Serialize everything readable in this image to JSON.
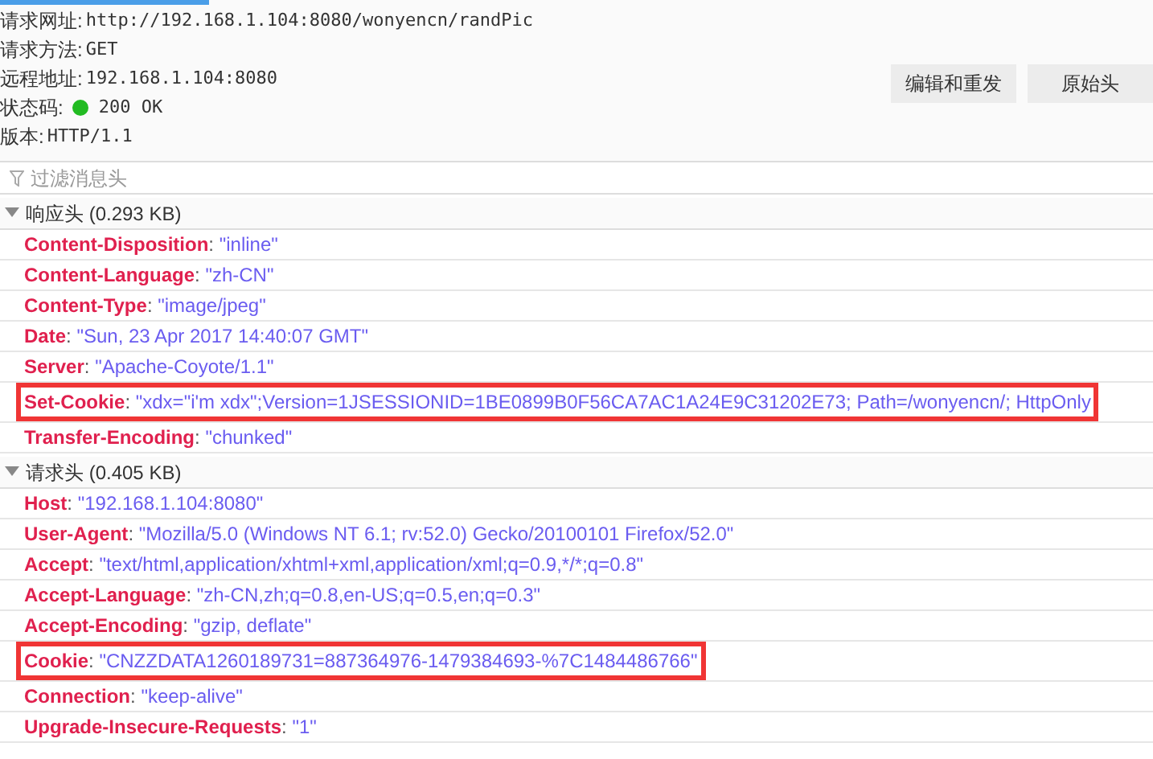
{
  "summary": [
    {
      "label": "请求网址:",
      "value": "http://192.168.1.104:8080/wonyencn/randPic"
    },
    {
      "label": "请求方法:",
      "value": "GET"
    },
    {
      "label": "远程地址:",
      "value": "192.168.1.104:8080"
    },
    {
      "label": "状态码:",
      "value": "200 OK",
      "color": "#22bb22"
    },
    {
      "label": "版本:",
      "value": "HTTP/1.1"
    }
  ],
  "buttons": [
    "编辑和重发",
    "原始头"
  ],
  "filter": {
    "placeholder": "过滤消息头"
  },
  "sections": [
    {
      "title": "响应头 (0.293 KB)",
      "expanded": true,
      "headers": [
        {
          "name": "Content-Disposition",
          "colon": ":",
          "value": "\"inline\"",
          "highlighted": false
        },
        {
          "name": "Content-Language",
          "colon": ":",
          "value": "\"zh-CN\"",
          "highlighted": false
        },
        {
          "name": "Content-Type",
          "colon": ":",
          "value": "\"image/jpeg\"",
          "highlighted": false
        },
        {
          "name": "Date",
          "colon": ":",
          "value": "\"Sun, 23 Apr 2017 14:40:07 GMT\"",
          "highlighted": false
        },
        {
          "name": "Server",
          "colon": ":",
          "value": "\"Apache-Coyote/1.1\"",
          "highlighted": false
        },
        {
          "name": "Set-Cookie",
          "colon": ":",
          "value": "\"xdx=\"i'm xdx\";Version=1JSESSIONID=1BE0899B0F56CA7AC1A24E9C31202E73; Path=/wonyencn/; HttpOnly",
          "highlighted": true
        },
        {
          "name": "Transfer-Encoding",
          "colon": ":",
          "value": "\"chunked\"",
          "highlighted": false
        }
      ]
    },
    {
      "title": "请求头 (0.405 KB)",
      "expanded": true,
      "headers": [
        {
          "name": "Host",
          "colon": ":",
          "value": "\"192.168.1.104:8080\"",
          "highlighted": false
        },
        {
          "name": "User-Agent",
          "colon": ":",
          "value": "\"Mozilla/5.0 (Windows NT 6.1; rv:52.0) Gecko/20100101 Firefox/52.0\"",
          "highlighted": false
        },
        {
          "name": "Accept",
          "colon": ":",
          "value": "\"text/html,application/xhtml+xml,application/xml;q=0.9,*/*;q=0.8\"",
          "highlighted": false
        },
        {
          "name": "Accept-Language",
          "colon": ":",
          "value": "\"zh-CN,zh;q=0.8,en-US;q=0.5,en;q=0.3\"",
          "highlighted": false
        },
        {
          "name": "Accept-Encoding",
          "colon": ":",
          "value": "\"gzip, deflate\"",
          "highlighted": false
        },
        {
          "name": "Cookie",
          "colon": ":",
          "value": "\"CNZZDATA1260189731=887364976-1479384693-%7C1484486766\"",
          "highlighted": true
        },
        {
          "name": "Connection",
          "colon": ":",
          "value": "\"keep-alive\"",
          "highlighted": false
        },
        {
          "name": "Upgrade-Insecure-Requests",
          "colon": ":",
          "value": "\"1\"",
          "highlighted": false
        }
      ]
    }
  ]
}
